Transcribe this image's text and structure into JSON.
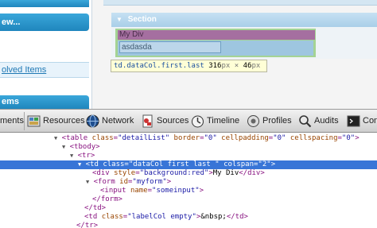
{
  "page": {
    "sidebar": {
      "new_label": "ew...",
      "solved_label": "olved Items",
      "items_label": "ems"
    },
    "section_title": "Section",
    "my_div_text": "My Div",
    "input_value": "asdasda",
    "tooltip": {
      "selector": "td.dataCol.first.last",
      "width": "316",
      "height": "46",
      "unit": "px",
      "times": "×"
    }
  },
  "toolbar": {
    "items": [
      {
        "label": "ments",
        "icon": "elements-icon"
      },
      {
        "label": "Resources",
        "icon": "resources-icon"
      },
      {
        "label": "Network",
        "icon": "network-icon"
      },
      {
        "label": "Sources",
        "icon": "sources-icon"
      },
      {
        "label": "Timeline",
        "icon": "timeline-icon"
      },
      {
        "label": "Profiles",
        "icon": "profiles-icon"
      },
      {
        "label": "Audits",
        "icon": "audits-icon"
      },
      {
        "label": "Con",
        "icon": "console-icon"
      }
    ]
  },
  "tree": {
    "l0": "<table class=\"detailList\" border=\"0\" cellpadding=\"0\" cellspacing=\"0\">",
    "l0_tag_open": "<table ",
    "l0_a1": "class",
    "l0_v1": "\"detailList\"",
    "l0_a2": "border",
    "l0_v2": "\"0\"",
    "l0_a3": "cellpadding",
    "l0_v3": "\"0\"",
    "l0_a4": "cellspacing",
    "l0_v4": "\"0\"",
    "l1": "<tbody>",
    "l2": "<tr>",
    "l3_open": "<td ",
    "l3_a1": "class",
    "l3_v1": "\"dataCol  first  last \"",
    "l3_a2": "colspan",
    "l3_v2": "\"2\"",
    "l4_open": "<div ",
    "l4_a1": "style",
    "l4_v1": "\"background:red\"",
    "l4_text": "My Div",
    "l4_close": "</div>",
    "l5_open": "<form ",
    "l5_a1": "id",
    "l5_v1": "\"myform\"",
    "l6_open": "<input ",
    "l6_a1": "name",
    "l6_v1": "\"someinput\"",
    "l7": "</form>",
    "l8": "</td>",
    "l9_open": "<td ",
    "l9_a1": "class",
    "l9_v1": "\"labelCol empty\"",
    "l9_text": "&nbsp;",
    "l9_close": "</td>",
    "l10": "</tr>"
  },
  "colors": {
    "accent_blue": "#1f86bd",
    "selection": "#3875d7",
    "tag": "#881280",
    "attr_name": "#994500",
    "attr_value": "#1a1aa6"
  }
}
